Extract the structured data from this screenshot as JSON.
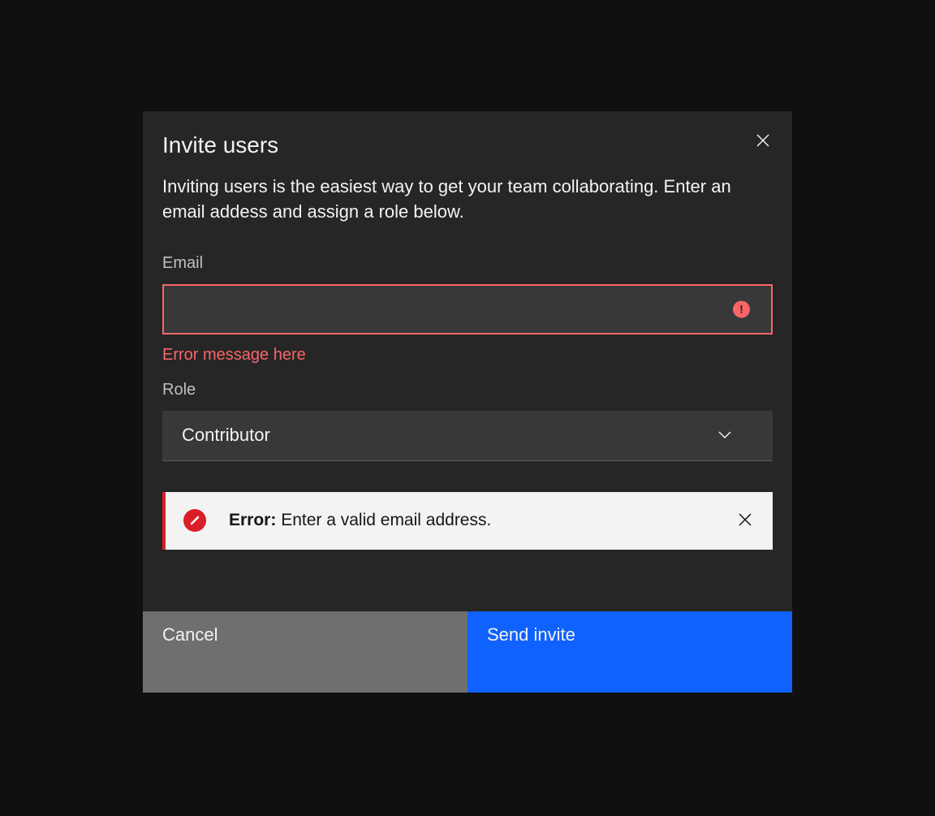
{
  "modal": {
    "title": "Invite users",
    "description": "Inviting users is the easiest way to get your team collaborating. Enter an email addess and assign a role below.",
    "email": {
      "label": "Email",
      "value": "",
      "error": "Error message here"
    },
    "role": {
      "label": "Role",
      "selected": "Contributor"
    },
    "notification": {
      "prefix": "Error:",
      "message": " Enter a valid email address."
    },
    "buttons": {
      "cancel": "Cancel",
      "send": "Send invite"
    }
  }
}
